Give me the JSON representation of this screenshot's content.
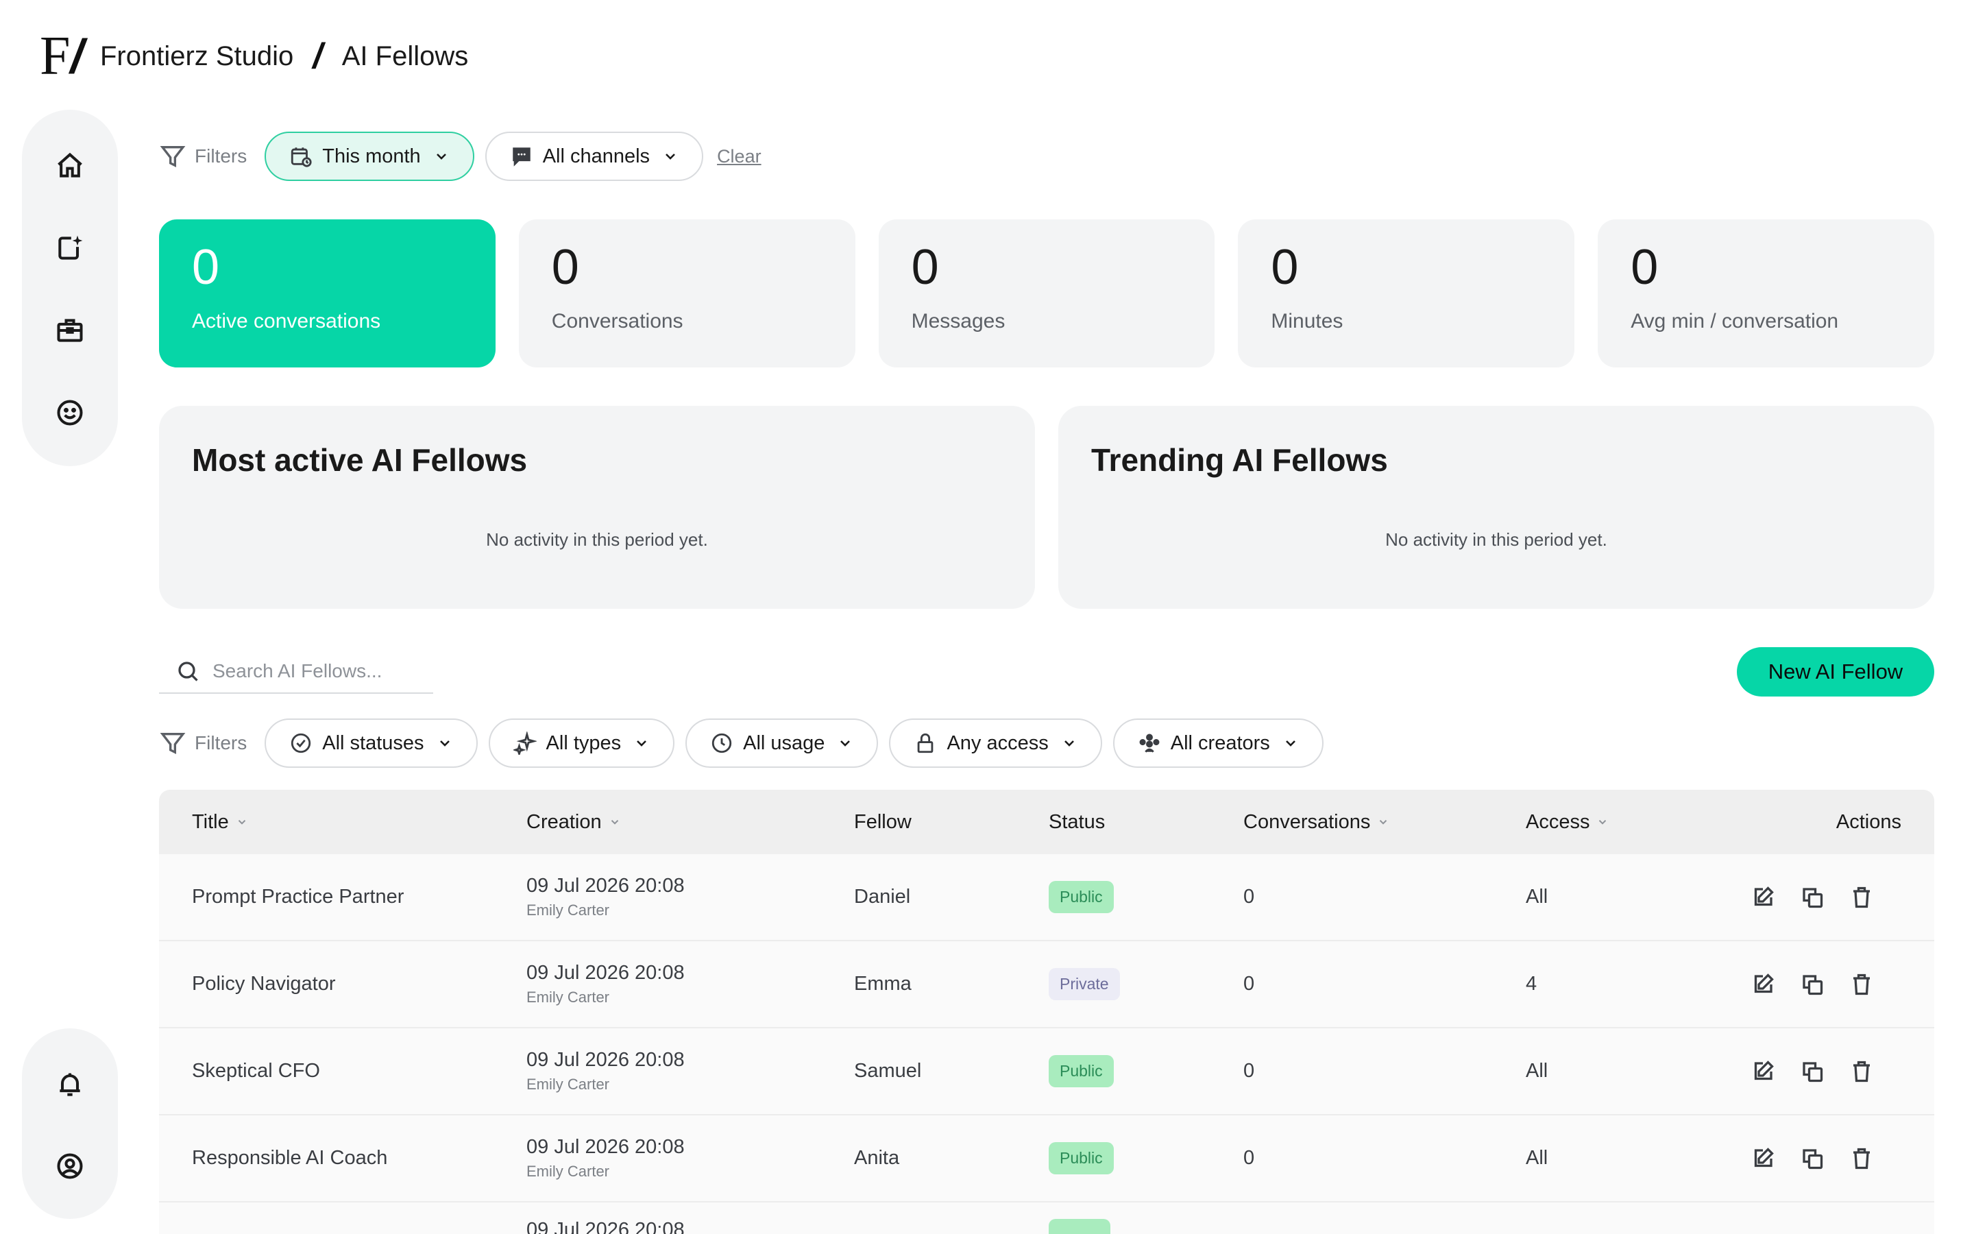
{
  "header": {
    "logo": "F",
    "org": "Frontierz Studio",
    "separator": "/",
    "page": "AI Fellows"
  },
  "sidebar": {
    "items": [
      {
        "icon": "home-icon"
      },
      {
        "icon": "new-note-icon"
      },
      {
        "icon": "briefcase-icon"
      },
      {
        "icon": "smiley-icon"
      }
    ],
    "bottom": [
      {
        "icon": "bell-icon"
      },
      {
        "icon": "user-circle-icon"
      }
    ]
  },
  "top_filters": {
    "label": "Filters",
    "period": "This month",
    "channels": "All channels",
    "clear": "Clear"
  },
  "stats": [
    {
      "value": "0",
      "label": "Active conversations"
    },
    {
      "value": "0",
      "label": "Conversations"
    },
    {
      "value": "0",
      "label": "Messages"
    },
    {
      "value": "0",
      "label": "Minutes"
    },
    {
      "value": "0",
      "label": "Avg min / conversation"
    }
  ],
  "panels": {
    "most_active": {
      "title": "Most active AI Fellows",
      "empty": "No activity in this period yet."
    },
    "trending": {
      "title": "Trending AI Fellows",
      "empty": "No activity in this period yet."
    }
  },
  "search": {
    "placeholder": "Search AI Fellows..."
  },
  "new_button": "New AI Fellow",
  "table_filters": {
    "label": "Filters",
    "statuses": "All statuses",
    "types": "All types",
    "usage": "All usage",
    "access": "Any access",
    "creators": "All creators"
  },
  "table": {
    "columns": {
      "title": "Title",
      "creation": "Creation",
      "fellow": "Fellow",
      "status": "Status",
      "conversations": "Conversations",
      "access": "Access",
      "actions": "Actions"
    },
    "rows": [
      {
        "title": "Prompt Practice Partner",
        "date": "09 Jul 2026 20:08",
        "creator": "Emily Carter",
        "fellow": "Daniel",
        "status": "Public",
        "conversations": "0",
        "access": "All"
      },
      {
        "title": "Policy Navigator",
        "date": "09 Jul 2026 20:08",
        "creator": "Emily Carter",
        "fellow": "Emma",
        "status": "Private",
        "conversations": "0",
        "access": "4"
      },
      {
        "title": "Skeptical CFO",
        "date": "09 Jul 2026 20:08",
        "creator": "Emily Carter",
        "fellow": "Samuel",
        "status": "Public",
        "conversations": "0",
        "access": "All"
      },
      {
        "title": "Responsible AI Coach",
        "date": "09 Jul 2026 20:08",
        "creator": "Emily Carter",
        "fellow": "Anita",
        "status": "Public",
        "conversations": "0",
        "access": "All"
      },
      {
        "title": "",
        "date": "09 Jul 2026 20:08",
        "creator": "",
        "fellow": "",
        "status": "",
        "conversations": "",
        "access": ""
      }
    ]
  },
  "colors": {
    "accent": "#06d6a7",
    "card_bg": "#f3f4f5",
    "public_badge": "#a9ecbe",
    "private_badge": "#ececf6"
  }
}
